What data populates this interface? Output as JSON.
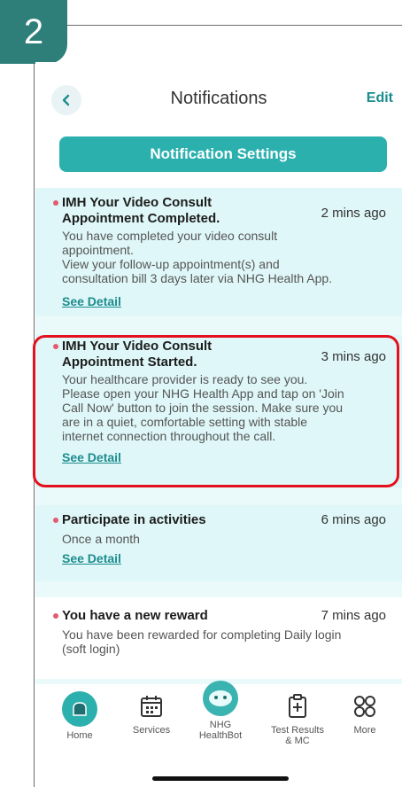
{
  "step_number": "2",
  "header": {
    "title": "Notifications",
    "edit_label": "Edit"
  },
  "settings_button": "Notification Settings",
  "notifications": [
    {
      "title_line1": "IMH Your Video Consult",
      "title_line2": "Appointment Completed.",
      "time": "2 mins ago",
      "desc_lines": [
        "You have completed your video consult",
        "appointment.",
        "View your follow-up appointment(s) and",
        "consultation bill 3 days later via NHG Health App."
      ],
      "link": "See Detail"
    },
    {
      "title_line1": "IMH Your Video Consult",
      "title_line2": "Appointment Started.",
      "time": "3 mins ago",
      "desc_lines": [
        "Your healthcare provider is ready to see you.",
        "Please open your NHG Health App and tap on 'Join",
        "Call Now' button to join the session. Make sure you",
        "are in a quiet, comfortable setting with stable",
        "internet connection throughout the call."
      ],
      "link": "See Detail"
    },
    {
      "title_line1": "Participate in activities",
      "time": "6 mins ago",
      "desc_lines": [
        "Once a month"
      ],
      "link": "See Detail"
    },
    {
      "title_line1": "You have a new reward",
      "time": "7 mins ago",
      "desc_lines": [
        "You have been rewarded for completing Daily login",
        "(soft login)"
      ]
    }
  ],
  "tabbar": {
    "home": "Home",
    "services": "Services",
    "bot_line1": "NHG",
    "bot_line2": "HealthBot",
    "results_line1": "Test Results",
    "results_line2": "& MC",
    "more": "More"
  },
  "colors": {
    "accent": "#2cb0ae",
    "card_bg": "#dff7f8",
    "highlight": "#e4101e",
    "unread_dot": "#e25b6f"
  }
}
